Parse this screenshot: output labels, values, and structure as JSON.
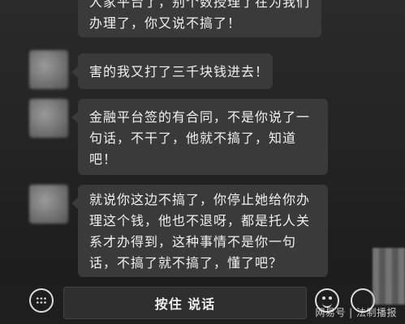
{
  "messages": [
    {
      "lines": [
        "人家平台了，别个数授理了在为我们",
        "办理了，你又说不搞了！"
      ]
    },
    {
      "lines": [
        "害的我又打了三千块钱进去！"
      ]
    },
    {
      "lines": [
        "金融平台签的有合同，不是你说了一",
        "句话，不干了，他就不搞了，知道",
        "吧！"
      ]
    },
    {
      "lines": [
        "就说你这边不搞了，你停止她给你办",
        "理这个钱，他也不退呀，都是托人关",
        "系才办得到，这种事情不是你一句",
        "话，不搞了就不搞了，懂了吧？"
      ]
    }
  ],
  "input_bar": {
    "voice_label": "按住 说话",
    "keyboard_icon": "keyboard-icon",
    "emoji_icon": "emoji-icon",
    "plus_icon": "plus-icon"
  },
  "watermark": "网易号 | 法制播报"
}
